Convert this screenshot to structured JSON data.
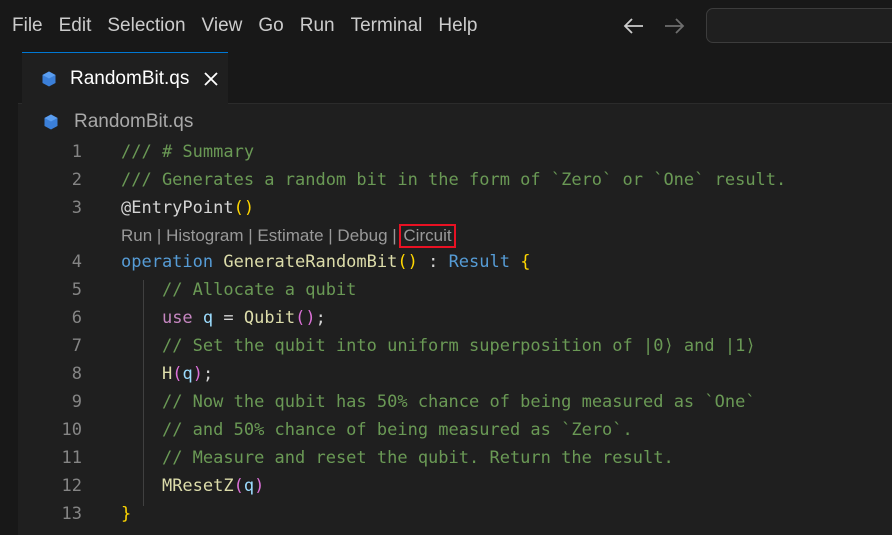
{
  "menu": {
    "items": [
      "File",
      "Edit",
      "Selection",
      "View",
      "Go",
      "Run",
      "Terminal",
      "Help"
    ]
  },
  "nav": {
    "back_icon": "arrow-left-icon",
    "forward_icon": "arrow-right-icon"
  },
  "tab": {
    "label": "RandomBit.qs",
    "icon": "qsharp-file-icon",
    "close_icon": "close-icon"
  },
  "breadcrumb": {
    "label": "RandomBit.qs",
    "icon": "qsharp-file-icon"
  },
  "colors": {
    "accent": "#0078d4",
    "highlight_box": "#e81123",
    "comment": "#6a9955",
    "keyword": "#569cd6"
  },
  "codelens": {
    "run": "Run",
    "histogram": "Histogram",
    "estimate": "Estimate",
    "debug": "Debug",
    "circuit": "Circuit",
    "separator": " | "
  },
  "editor": {
    "line_numbers": [
      "1",
      "2",
      "3",
      "4",
      "5",
      "6",
      "7",
      "8",
      "9",
      "10",
      "11",
      "12",
      "13"
    ],
    "lines": [
      [
        {
          "t": "comment",
          "v": "/// # Summary"
        }
      ],
      [
        {
          "t": "comment",
          "v": "/// Generates a random bit in the form of `Zero` or `One` result."
        }
      ],
      [
        {
          "t": "plain",
          "v": "@EntryPoint"
        },
        {
          "t": "brace",
          "v": "()"
        }
      ],
      [
        {
          "t": "kw",
          "v": "operation "
        },
        {
          "t": "fn",
          "v": "GenerateRandomBit"
        },
        {
          "t": "brace",
          "v": "()"
        },
        {
          "t": "plain",
          "v": " : "
        },
        {
          "t": "kw",
          "v": "Result"
        },
        {
          "t": "plain",
          "v": " "
        },
        {
          "t": "brace",
          "v": "{"
        }
      ],
      [
        {
          "t": "plain",
          "v": "    "
        },
        {
          "t": "comment",
          "v": "// Allocate a qubit"
        }
      ],
      [
        {
          "t": "plain",
          "v": "    "
        },
        {
          "t": "ctrl",
          "v": "use"
        },
        {
          "t": "plain",
          "v": " "
        },
        {
          "t": "var",
          "v": "q"
        },
        {
          "t": "plain",
          "v": " = "
        },
        {
          "t": "fn",
          "v": "Qubit"
        },
        {
          "t": "paren",
          "v": "()"
        },
        {
          "t": "plain",
          "v": ";"
        }
      ],
      [
        {
          "t": "plain",
          "v": "    "
        },
        {
          "t": "comment",
          "v": "// Set the qubit into uniform superposition of |0⟩ and |1⟩"
        }
      ],
      [
        {
          "t": "plain",
          "v": "    "
        },
        {
          "t": "fn",
          "v": "H"
        },
        {
          "t": "paren",
          "v": "("
        },
        {
          "t": "var",
          "v": "q"
        },
        {
          "t": "paren",
          "v": ")"
        },
        {
          "t": "plain",
          "v": ";"
        }
      ],
      [
        {
          "t": "plain",
          "v": "    "
        },
        {
          "t": "comment",
          "v": "// Now the qubit has 50% chance of being measured as `One`"
        }
      ],
      [
        {
          "t": "plain",
          "v": "    "
        },
        {
          "t": "comment",
          "v": "// and 50% chance of being measured as `Zero`."
        }
      ],
      [
        {
          "t": "plain",
          "v": "    "
        },
        {
          "t": "comment",
          "v": "// Measure and reset the qubit. Return the result."
        }
      ],
      [
        {
          "t": "plain",
          "v": "    "
        },
        {
          "t": "fn",
          "v": "MResetZ"
        },
        {
          "t": "paren",
          "v": "("
        },
        {
          "t": "var",
          "v": "q"
        },
        {
          "t": "paren",
          "v": ")"
        }
      ],
      [
        {
          "t": "brace",
          "v": "}"
        }
      ]
    ]
  }
}
